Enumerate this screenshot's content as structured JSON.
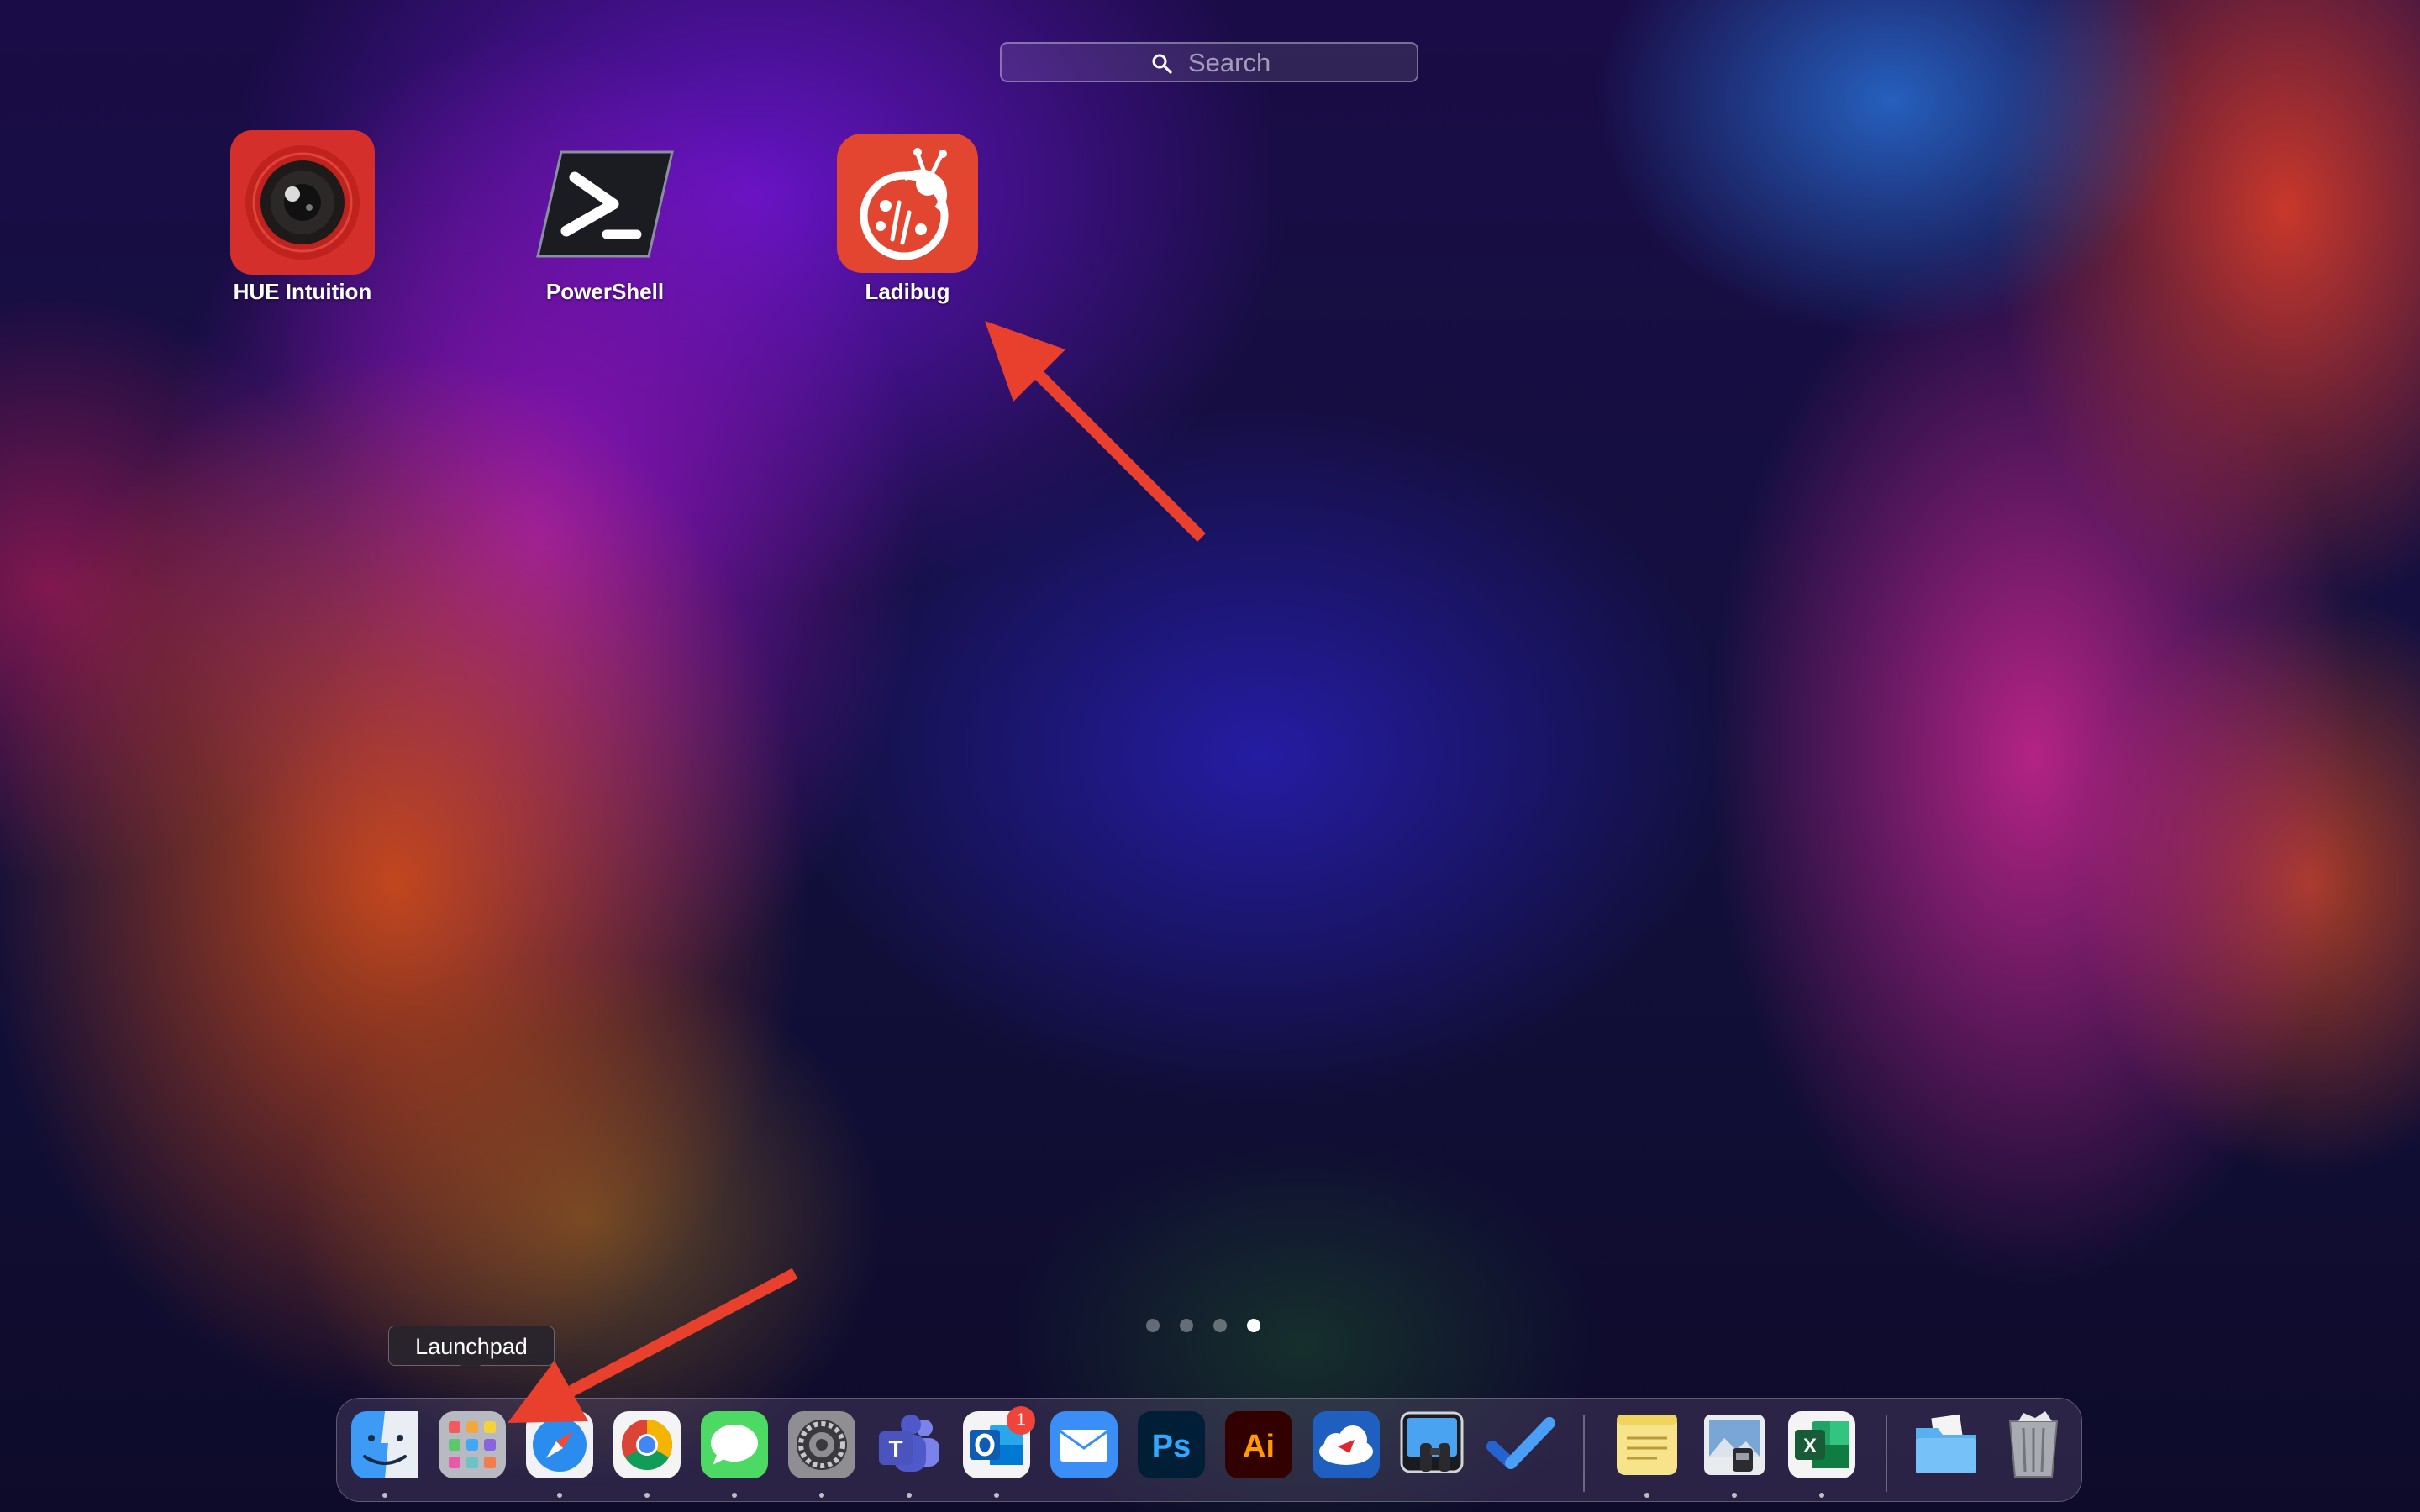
{
  "search": {
    "placeholder": "Search"
  },
  "apps": [
    {
      "label": "HUE Intuition"
    },
    {
      "label": "PowerShell"
    },
    {
      "label": "Ladibug"
    }
  ],
  "page_indicator": {
    "total": 4,
    "current": 4
  },
  "tooltip": {
    "label": "Launchpad"
  },
  "dock": {
    "items": [
      {
        "name": "Finder",
        "icon": "finder-icon"
      },
      {
        "name": "Launchpad",
        "icon": "launchpad-icon"
      },
      {
        "name": "Safari",
        "icon": "safari-icon"
      },
      {
        "name": "Google Chrome",
        "icon": "chrome-icon"
      },
      {
        "name": "Messages",
        "icon": "messages-icon"
      },
      {
        "name": "System Preferences",
        "icon": "settings-gear-icon"
      },
      {
        "name": "Microsoft Teams",
        "icon": "teams-icon"
      },
      {
        "name": "Microsoft Outlook",
        "icon": "outlook-icon",
        "badge": "1"
      },
      {
        "name": "Mail",
        "icon": "mail-icon"
      },
      {
        "name": "Photoshop",
        "icon": "photoshop-icon",
        "text": "Ps"
      },
      {
        "name": "Illustrator",
        "icon": "illustrator-icon",
        "text": "Ai"
      },
      {
        "name": "Cloud App",
        "icon": "cloud-icon"
      },
      {
        "name": "Preview Binoculars App",
        "icon": "binoculars-icon"
      },
      {
        "name": "To Do",
        "icon": "checkmark-icon"
      },
      {
        "name": "Stickies",
        "icon": "stickies-icon"
      },
      {
        "name": "Preview",
        "icon": "preview-icon"
      },
      {
        "name": "Microsoft Excel",
        "icon": "excel-icon",
        "text": "X"
      },
      {
        "name": "Downloads Folder",
        "icon": "folder-icon"
      },
      {
        "name": "Trash",
        "icon": "trash-icon"
      }
    ]
  },
  "colors": {
    "annotation_arrow": "#e8402c",
    "badge": "#f0443a"
  }
}
